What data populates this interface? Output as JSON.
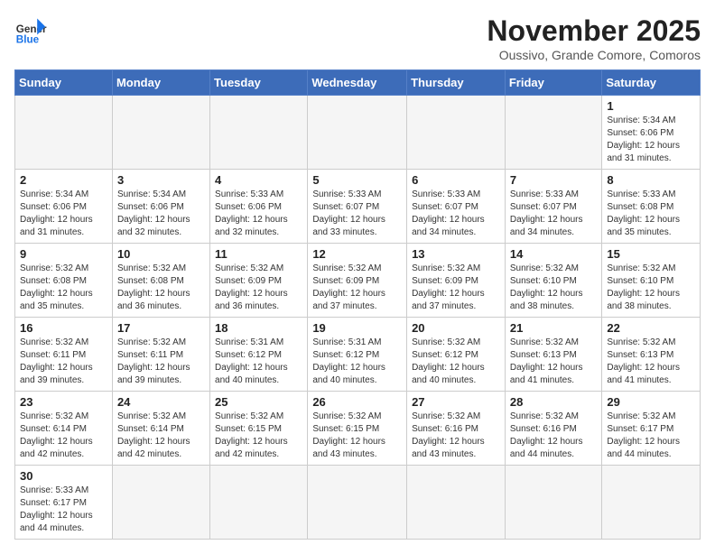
{
  "logo": {
    "text_general": "General",
    "text_blue": "Blue"
  },
  "header": {
    "month": "November 2025",
    "location": "Oussivo, Grande Comore, Comoros"
  },
  "weekdays": [
    "Sunday",
    "Monday",
    "Tuesday",
    "Wednesday",
    "Thursday",
    "Friday",
    "Saturday"
  ],
  "weeks": [
    [
      {
        "day": "",
        "info": ""
      },
      {
        "day": "",
        "info": ""
      },
      {
        "day": "",
        "info": ""
      },
      {
        "day": "",
        "info": ""
      },
      {
        "day": "",
        "info": ""
      },
      {
        "day": "",
        "info": ""
      },
      {
        "day": "1",
        "info": "Sunrise: 5:34 AM\nSunset: 6:06 PM\nDaylight: 12 hours and 31 minutes."
      }
    ],
    [
      {
        "day": "2",
        "info": "Sunrise: 5:34 AM\nSunset: 6:06 PM\nDaylight: 12 hours and 31 minutes."
      },
      {
        "day": "3",
        "info": "Sunrise: 5:34 AM\nSunset: 6:06 PM\nDaylight: 12 hours and 32 minutes."
      },
      {
        "day": "4",
        "info": "Sunrise: 5:33 AM\nSunset: 6:06 PM\nDaylight: 12 hours and 32 minutes."
      },
      {
        "day": "5",
        "info": "Sunrise: 5:33 AM\nSunset: 6:07 PM\nDaylight: 12 hours and 33 minutes."
      },
      {
        "day": "6",
        "info": "Sunrise: 5:33 AM\nSunset: 6:07 PM\nDaylight: 12 hours and 34 minutes."
      },
      {
        "day": "7",
        "info": "Sunrise: 5:33 AM\nSunset: 6:07 PM\nDaylight: 12 hours and 34 minutes."
      },
      {
        "day": "8",
        "info": "Sunrise: 5:33 AM\nSunset: 6:08 PM\nDaylight: 12 hours and 35 minutes."
      }
    ],
    [
      {
        "day": "9",
        "info": "Sunrise: 5:32 AM\nSunset: 6:08 PM\nDaylight: 12 hours and 35 minutes."
      },
      {
        "day": "10",
        "info": "Sunrise: 5:32 AM\nSunset: 6:08 PM\nDaylight: 12 hours and 36 minutes."
      },
      {
        "day": "11",
        "info": "Sunrise: 5:32 AM\nSunset: 6:09 PM\nDaylight: 12 hours and 36 minutes."
      },
      {
        "day": "12",
        "info": "Sunrise: 5:32 AM\nSunset: 6:09 PM\nDaylight: 12 hours and 37 minutes."
      },
      {
        "day": "13",
        "info": "Sunrise: 5:32 AM\nSunset: 6:09 PM\nDaylight: 12 hours and 37 minutes."
      },
      {
        "day": "14",
        "info": "Sunrise: 5:32 AM\nSunset: 6:10 PM\nDaylight: 12 hours and 38 minutes."
      },
      {
        "day": "15",
        "info": "Sunrise: 5:32 AM\nSunset: 6:10 PM\nDaylight: 12 hours and 38 minutes."
      }
    ],
    [
      {
        "day": "16",
        "info": "Sunrise: 5:32 AM\nSunset: 6:11 PM\nDaylight: 12 hours and 39 minutes."
      },
      {
        "day": "17",
        "info": "Sunrise: 5:32 AM\nSunset: 6:11 PM\nDaylight: 12 hours and 39 minutes."
      },
      {
        "day": "18",
        "info": "Sunrise: 5:31 AM\nSunset: 6:12 PM\nDaylight: 12 hours and 40 minutes."
      },
      {
        "day": "19",
        "info": "Sunrise: 5:31 AM\nSunset: 6:12 PM\nDaylight: 12 hours and 40 minutes."
      },
      {
        "day": "20",
        "info": "Sunrise: 5:32 AM\nSunset: 6:12 PM\nDaylight: 12 hours and 40 minutes."
      },
      {
        "day": "21",
        "info": "Sunrise: 5:32 AM\nSunset: 6:13 PM\nDaylight: 12 hours and 41 minutes."
      },
      {
        "day": "22",
        "info": "Sunrise: 5:32 AM\nSunset: 6:13 PM\nDaylight: 12 hours and 41 minutes."
      }
    ],
    [
      {
        "day": "23",
        "info": "Sunrise: 5:32 AM\nSunset: 6:14 PM\nDaylight: 12 hours and 42 minutes."
      },
      {
        "day": "24",
        "info": "Sunrise: 5:32 AM\nSunset: 6:14 PM\nDaylight: 12 hours and 42 minutes."
      },
      {
        "day": "25",
        "info": "Sunrise: 5:32 AM\nSunset: 6:15 PM\nDaylight: 12 hours and 42 minutes."
      },
      {
        "day": "26",
        "info": "Sunrise: 5:32 AM\nSunset: 6:15 PM\nDaylight: 12 hours and 43 minutes."
      },
      {
        "day": "27",
        "info": "Sunrise: 5:32 AM\nSunset: 6:16 PM\nDaylight: 12 hours and 43 minutes."
      },
      {
        "day": "28",
        "info": "Sunrise: 5:32 AM\nSunset: 6:16 PM\nDaylight: 12 hours and 44 minutes."
      },
      {
        "day": "29",
        "info": "Sunrise: 5:32 AM\nSunset: 6:17 PM\nDaylight: 12 hours and 44 minutes."
      }
    ],
    [
      {
        "day": "30",
        "info": "Sunrise: 5:33 AM\nSunset: 6:17 PM\nDaylight: 12 hours and 44 minutes."
      },
      {
        "day": "",
        "info": ""
      },
      {
        "day": "",
        "info": ""
      },
      {
        "day": "",
        "info": ""
      },
      {
        "day": "",
        "info": ""
      },
      {
        "day": "",
        "info": ""
      },
      {
        "day": "",
        "info": ""
      }
    ]
  ]
}
